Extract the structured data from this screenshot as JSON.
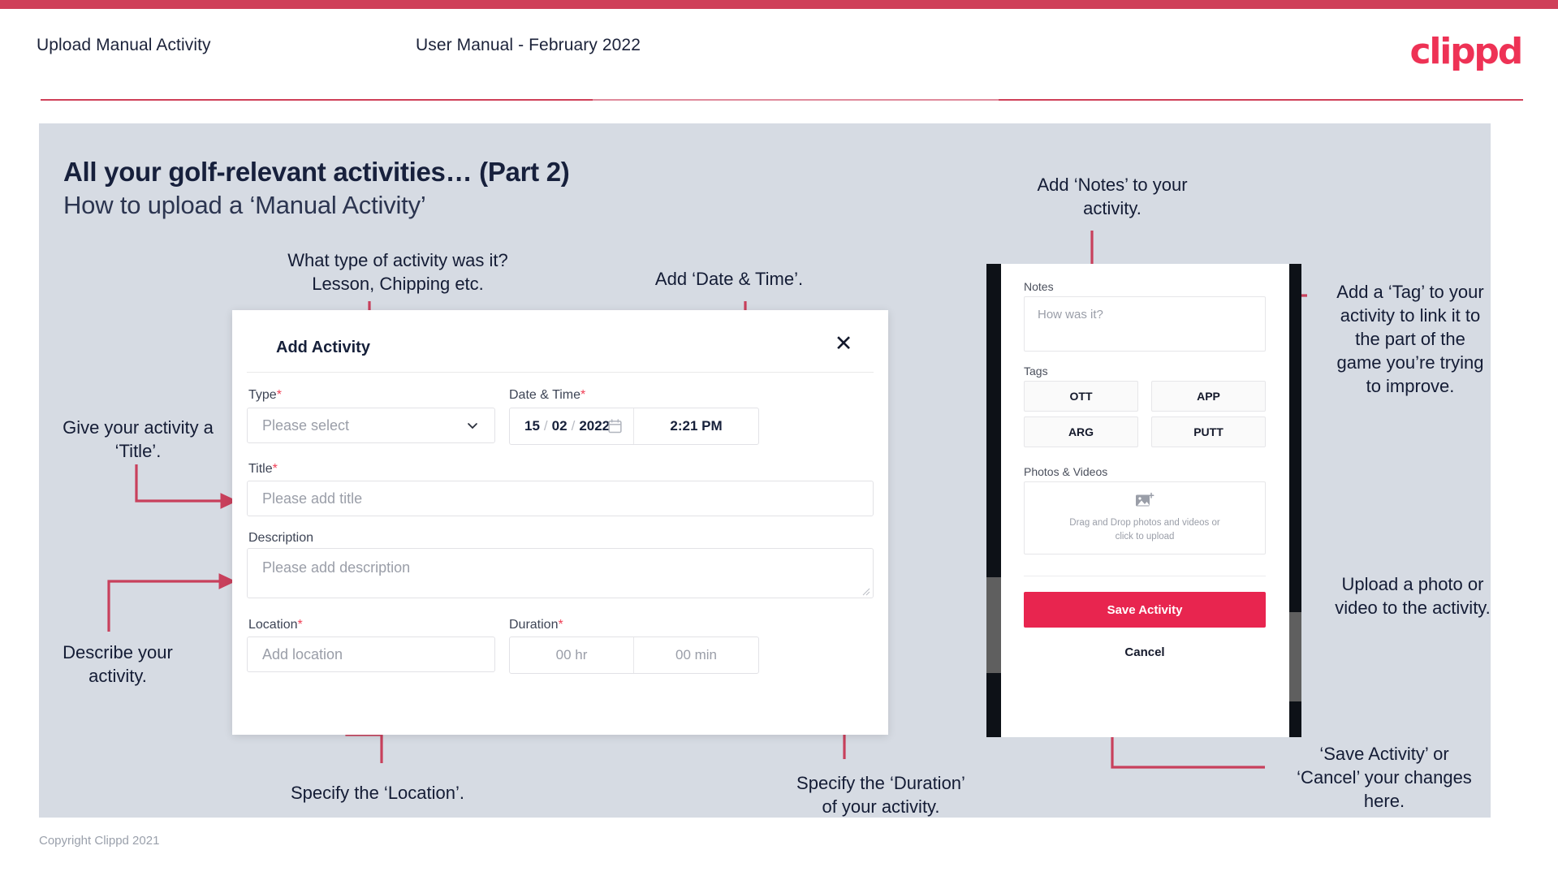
{
  "header": {
    "left_title": "Upload Manual Activity",
    "center_title": "User Manual - February 2022",
    "logo": "clippd"
  },
  "slide": {
    "title": "All your golf-relevant activities… (Part 2)",
    "subtitle": "How to upload a ‘Manual Activity’"
  },
  "annotations": {
    "type_note": "What type of activity was it?\nLesson, Chipping etc.",
    "datetime_note": "Add ‘Date & Time’.",
    "title_note": "Give your activity a\n‘Title’.",
    "description_note": "Describe your\nactivity.",
    "location_note": "Specify the ‘Location’.",
    "duration_note": "Specify the ‘Duration’\nof your activity.",
    "notes_note": "Add ‘Notes’ to your\nactivity.",
    "tag_note": "Add a ‘Tag’ to your\nactivity to link it to\nthe part of the\ngame you’re trying\nto improve.",
    "upload_note": "Upload a photo or\nvideo to the activity.",
    "save_note": "‘Save Activity’ or\n‘Cancel’ your changes\nhere."
  },
  "dialog": {
    "title": "Add Activity",
    "close_icon": "close-icon",
    "fields": {
      "type": {
        "label": "Type",
        "required": "*",
        "placeholder": "Please select",
        "chevron_icon": "chevron-down-icon"
      },
      "datetime": {
        "label": "Date & Time",
        "required": "*",
        "day": "15",
        "sep1": "/",
        "month": "02",
        "sep2": "/",
        "year": "2022",
        "calendar_icon": "calendar-icon",
        "time": "2:21 PM"
      },
      "title": {
        "label": "Title",
        "required": "*",
        "placeholder": "Please add title"
      },
      "description": {
        "label": "Description",
        "placeholder": "Please add description"
      },
      "location": {
        "label": "Location",
        "required": "*",
        "placeholder": "Add location"
      },
      "duration": {
        "label": "Duration",
        "required": "*",
        "hours": "00 hr",
        "minutes": "00 min"
      }
    }
  },
  "phone": {
    "notes": {
      "label": "Notes",
      "placeholder": "How was it?"
    },
    "tags": {
      "label": "Tags",
      "items": [
        "OTT",
        "APP",
        "ARG",
        "PUTT"
      ]
    },
    "photos": {
      "label": "Photos & Videos",
      "icon": "add-image-icon",
      "dropzone_text": "Drag and Drop photos and videos or\nclick to upload"
    },
    "save_label": "Save Activity",
    "cancel_label": "Cancel"
  },
  "footer": {
    "copyright": "Copyright Clippd 2021"
  },
  "colors": {
    "accent": "#e8254f",
    "header_rule": "#cf4059",
    "panel_bg": "#d6dbe3",
    "text_dark": "#16203a",
    "arrow": "#c8405c"
  }
}
